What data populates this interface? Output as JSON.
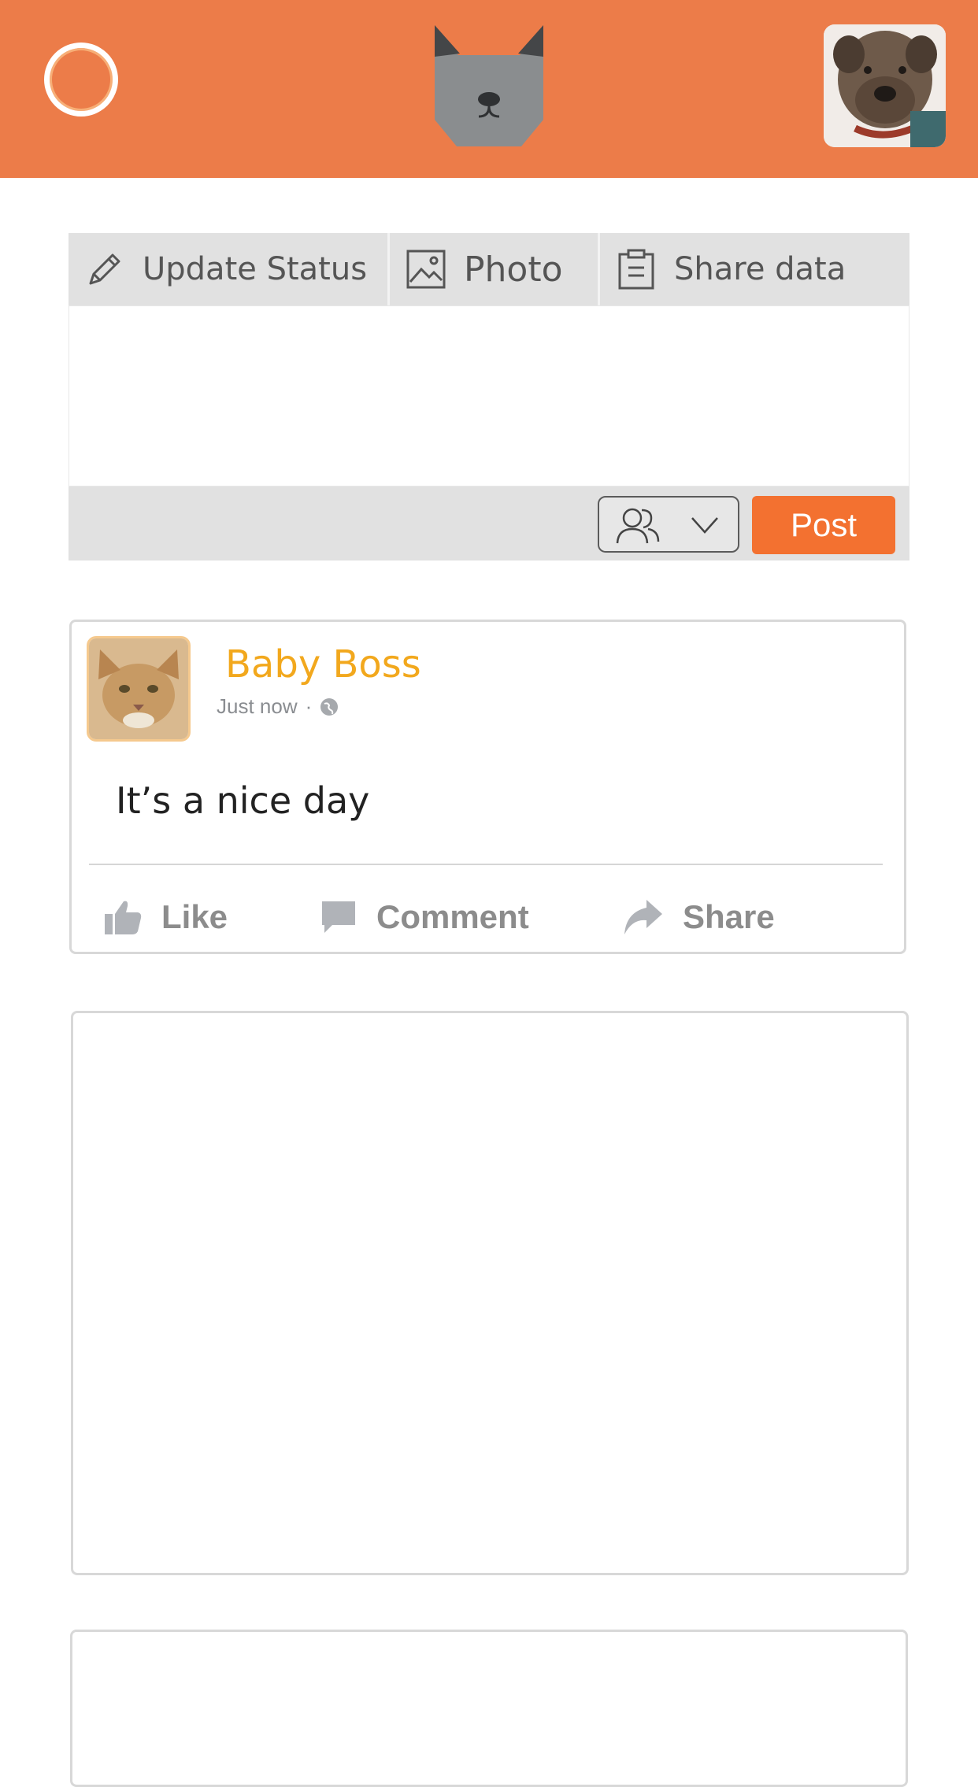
{
  "header": {
    "menu_icon": "ring-icon",
    "logo_icon": "cat-face-icon",
    "profile_avatar": "dog-avatar"
  },
  "composer": {
    "tabs": [
      {
        "label": "Update Status",
        "icon": "pencil-icon"
      },
      {
        "label": "Photo",
        "icon": "image-icon"
      },
      {
        "label": "Share data",
        "icon": "clipboard-icon"
      }
    ],
    "audience_icon": "people-icon",
    "post_label": "Post"
  },
  "post": {
    "author": "Baby Boss",
    "time": "Just now",
    "privacy_icon": "globe-icon",
    "text": "It’s a nice day",
    "actions": {
      "like": "Like",
      "comment": "Comment",
      "share": "Share"
    }
  },
  "colors": {
    "header_bg": "#ec7c49",
    "post_button": "#f37130",
    "author_name": "#f2a81d",
    "tab_bg": "#e1e1e1",
    "action_text": "#8c8c8c"
  }
}
